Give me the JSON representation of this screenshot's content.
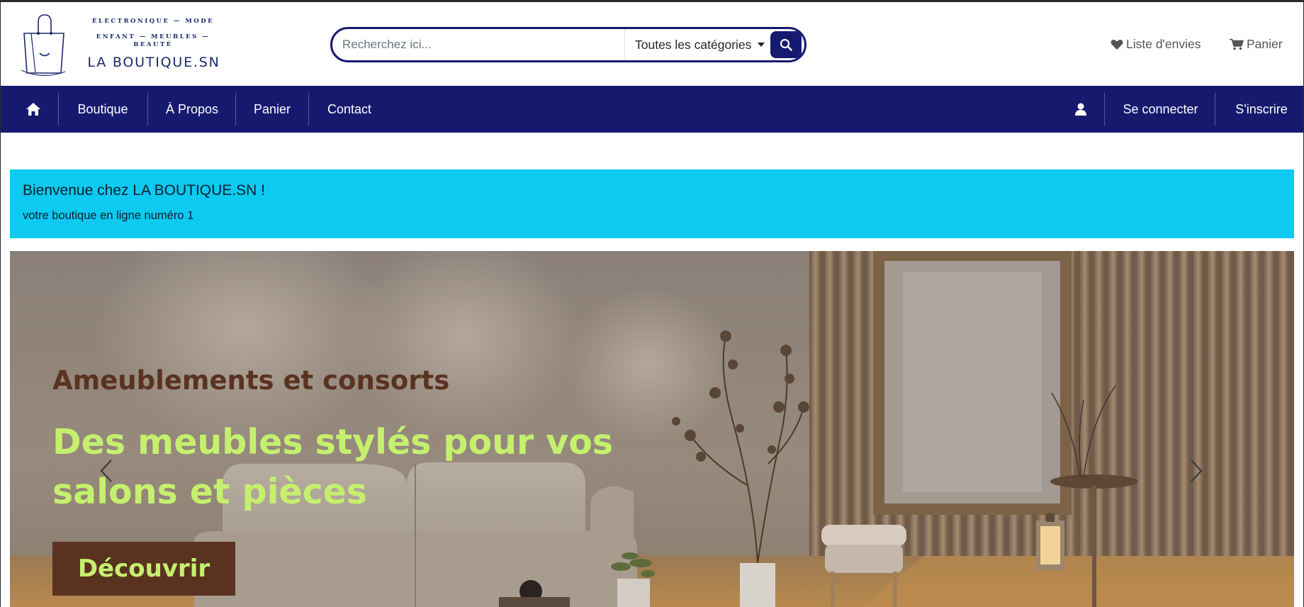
{
  "brand": {
    "tagline_line1": "ÉLECTRONIQUE — MODE",
    "tagline_line2": "ENFANT — MEUBLES — BEAUTÉ",
    "name": "LA BOUTIQUE.SN"
  },
  "search": {
    "placeholder": "Recherchez ici...",
    "category": "Toutes les catégories"
  },
  "header_links": {
    "wishlist": "Liste d'envies",
    "cart": "Panier"
  },
  "nav": {
    "items": [
      {
        "label": "Boutique"
      },
      {
        "label": "À Propos"
      },
      {
        "label": "Panier"
      },
      {
        "label": "Contact"
      }
    ],
    "login": "Se connecter",
    "signup": "S'inscrire"
  },
  "alert": {
    "title": "Bienvenue chez LA BOUTIQUE.SN !",
    "subtitle": "votre boutique en ligne numéro 1"
  },
  "carousel": {
    "kicker": "Ameublements et consorts",
    "title": "Des meubles stylés pour vos salons et pièces",
    "button": "Découvrir"
  },
  "colors": {
    "navy": "#161a6e",
    "info": "#0dcaf0",
    "slide_accent": "#c5f06e",
    "slide_brown": "#5a3320"
  },
  "icons": {
    "home": "home-icon",
    "search": "search-icon",
    "heart": "heart-icon",
    "cart": "cart-icon",
    "user": "user-icon",
    "prev": "chevron-left-icon",
    "next": "chevron-right-icon"
  }
}
